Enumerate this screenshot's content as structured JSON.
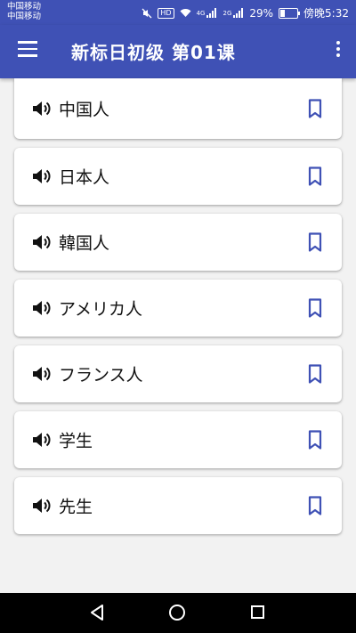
{
  "status_bar": {
    "carrier_1": "中国移动",
    "carrier_2": "中国移动",
    "hd_badge": "HD",
    "net_1": "4G",
    "net_2": "2G",
    "battery": "29%",
    "battery_level": 0.29,
    "time": "傍晚5:32"
  },
  "app_bar": {
    "title": "新标日初级 第01课",
    "menu_icon": "menu-icon",
    "more_icon": "more-vert-icon",
    "color": "#3f51b5"
  },
  "words": [
    {
      "text": "中国人"
    },
    {
      "text": "日本人"
    },
    {
      "text": "韓国人"
    },
    {
      "text": "アメリカ人"
    },
    {
      "text": "フランス人"
    },
    {
      "text": "学生"
    },
    {
      "text": "先生"
    }
  ],
  "icons": {
    "speaker": "volume-up-icon",
    "bookmark": "bookmark-border-icon",
    "bookmark_color": "#3f51b5"
  }
}
